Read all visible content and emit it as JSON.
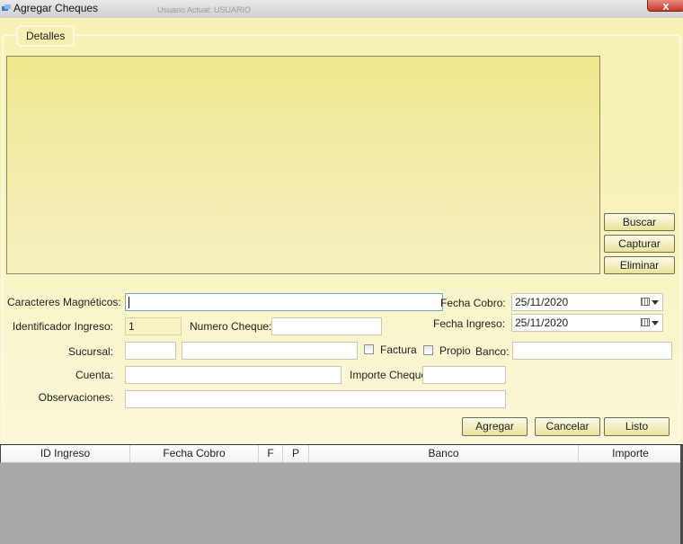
{
  "window": {
    "title": "Agregar Cheques",
    "background_title": "Usuario Actual: USUARIO",
    "close_symbol": "x"
  },
  "group": {
    "legend": "Detalles"
  },
  "side_buttons": {
    "buscar": "Buscar",
    "capturar": "Capturar",
    "eliminar": "Eliminar"
  },
  "form": {
    "caracteres_label": "Caracteres Magnéticos:",
    "caracteres_value": "",
    "fecha_cobro_label": "Fecha Cobro:",
    "fecha_cobro_value": "25/11/2020",
    "identificador_label": "Identificador Ingreso:",
    "identificador_value": "1",
    "numero_cheque_label": "Numero Cheque:",
    "numero_cheque_value": "",
    "fecha_ingreso_label": "Fecha Ingreso:",
    "fecha_ingreso_value": "25/11/2020",
    "sucursal_label": "Sucursal:",
    "sucursal_code": "",
    "sucursal_name": "",
    "factura_label": "Factura",
    "factura_checked": false,
    "propio_label": "Propio",
    "propio_checked": false,
    "banco_label": "Banco:",
    "banco_value": "",
    "cuenta_label": "Cuenta:",
    "cuenta_value": "",
    "importe_label": "Importe Cheque:",
    "importe_value": "",
    "observaciones_label": "Observaciones:",
    "observaciones_value": ""
  },
  "actions": {
    "agregar": "Agregar",
    "cancelar": "Cancelar",
    "listo": "Listo"
  },
  "grid": {
    "columns": [
      "ID Ingreso",
      "Fecha Cobro",
      "F",
      "P",
      "Banco",
      "Importe"
    ],
    "rows": []
  },
  "colors": {
    "form_background": "#f7f2b6",
    "button_face": "#e9e39a",
    "grid_background": "#a8a8a8",
    "close_button": "#c3392a"
  },
  "icons": {
    "app": "app-icon",
    "close": "close-icon",
    "calendar": "calendar-icon",
    "dropdown": "chevron-down-icon"
  }
}
